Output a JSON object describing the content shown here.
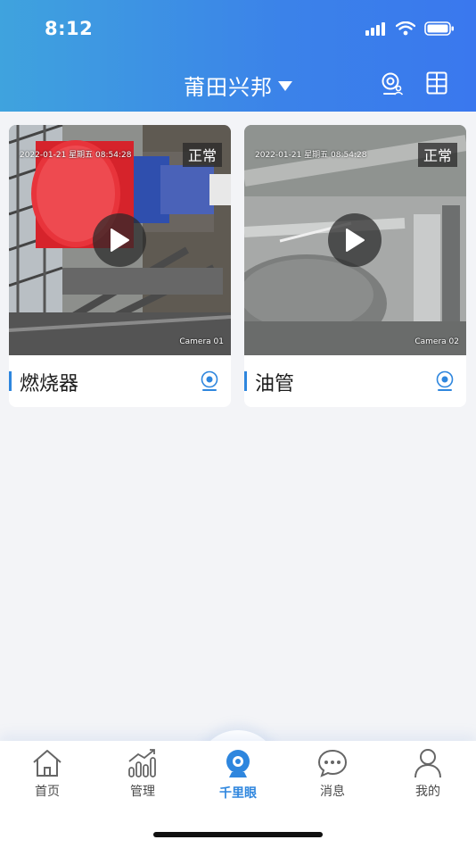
{
  "status_bar": {
    "time": "8:12"
  },
  "header": {
    "title": "莆田兴邦"
  },
  "cameras": [
    {
      "timestamp": "2022-01-21 星期五 08:54:28",
      "status": "正常",
      "camera_label": "Camera 01",
      "name": "燃烧器"
    },
    {
      "timestamp": "2022-01-21 星期五 08:54:28",
      "status": "正常",
      "camera_label": "Camera 02",
      "name": "油管"
    }
  ],
  "tabbar": {
    "items": [
      {
        "label": "首页",
        "icon": "home-icon"
      },
      {
        "label": "管理",
        "icon": "bar-chart-icon"
      },
      {
        "label": "千里眼",
        "icon": "webcam-icon"
      },
      {
        "label": "消息",
        "icon": "chat-icon"
      },
      {
        "label": "我的",
        "icon": "user-icon"
      }
    ],
    "active_index": 2
  },
  "colors": {
    "accent": "#2e86de",
    "header_start": "#3fa3de",
    "header_end": "#3a78ee"
  }
}
